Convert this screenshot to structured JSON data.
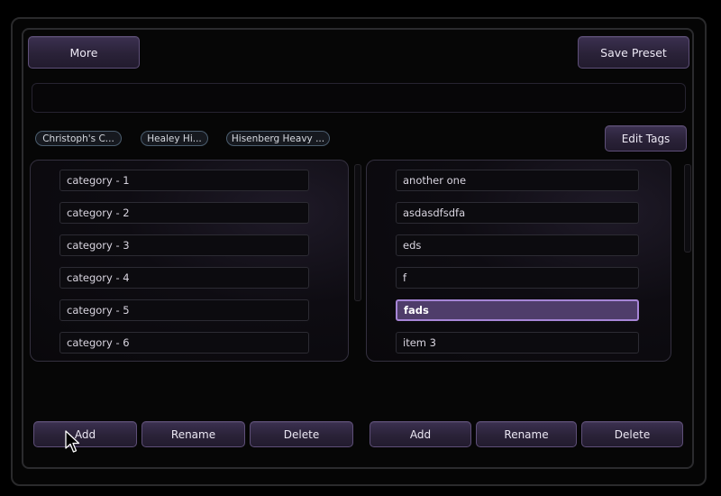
{
  "toolbar": {
    "more_label": "More",
    "save_preset_label": "Save Preset"
  },
  "search": {
    "value": "",
    "placeholder": ""
  },
  "tags": [
    "Christoph's C...",
    "Healey Hi...",
    "Hisenberg Heavy ..."
  ],
  "edit_tags_label": "Edit Tags",
  "categories": {
    "items": [
      "category - 1",
      "category - 2",
      "category - 3",
      "category - 4",
      "category - 5",
      "category - 6"
    ],
    "add_label": "Add",
    "rename_label": "Rename",
    "delete_label": "Delete"
  },
  "presets": {
    "items": [
      "another one",
      "asdasdfsdfa",
      "eds",
      "f",
      "fads",
      "item 3"
    ],
    "selected": "fads",
    "add_label": "Add",
    "rename_label": "Rename",
    "delete_label": "Delete"
  },
  "colors": {
    "accent": "#a685d6",
    "button_border": "#5e4f78",
    "selected_fill": "#4f3d6a"
  }
}
